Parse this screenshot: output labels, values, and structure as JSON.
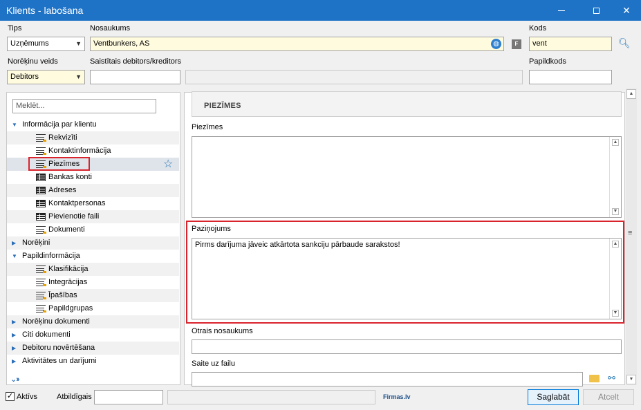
{
  "window": {
    "title": "Klients - labošana"
  },
  "header": {
    "tips_label": "Tips",
    "tips_value": "Uzņēmums",
    "nosaukums_label": "Nosaukums",
    "nosaukums_value": "Ventbunkers, AS",
    "f_label": "F",
    "kods_label": "Kods",
    "kods_value": "vent",
    "norekinu_veids_label": "Norēķinu veids",
    "norekinu_veids_value": "Debitors",
    "saistitais_label": "Saistītais debitors/kreditors",
    "saistitais_value": "",
    "papildkods_label": "Papildkods",
    "papildkods_value": ""
  },
  "tree": {
    "search_placeholder": "Meklēt...",
    "items": [
      {
        "label": "Informācija par klientu"
      },
      {
        "label": "Rekvizīti"
      },
      {
        "label": "Kontaktinformācija"
      },
      {
        "label": "Piezīmes"
      },
      {
        "label": "Bankas konti"
      },
      {
        "label": "Adreses"
      },
      {
        "label": "Kontaktpersonas"
      },
      {
        "label": "Pievienotie faili"
      },
      {
        "label": "Dokumenti"
      },
      {
        "label": "Norēķini"
      },
      {
        "label": "Papildinformācija"
      },
      {
        "label": "Klasifikācija"
      },
      {
        "label": "Integrācijas"
      },
      {
        "label": "Īpašības"
      },
      {
        "label": "Papildgrupas"
      },
      {
        "label": "Norēķinu dokumenti"
      },
      {
        "label": "Citi dokumenti"
      },
      {
        "label": "Debitoru novērtēšana"
      },
      {
        "label": "Aktivitātes un darījumi"
      }
    ]
  },
  "main": {
    "section_title": "PIEZĪMES",
    "piezimes_label": "Piezīmes",
    "piezimes_value": "",
    "pazinojums_label": "Paziņojums",
    "pazinojums_value": "Pirms darījuma jāveic atkārtota sankciju pārbaude sarakstos!",
    "otrais_label": "Otrais nosaukums",
    "otrais_value": "",
    "saite_label": "Saite uz failu",
    "saite_value": ""
  },
  "footer": {
    "aktivs_label": "Aktīvs",
    "aktivs_checked": true,
    "atbildigais_label": "Atbildīgais",
    "atbildigais_value": "",
    "brand": "Firmas.lv",
    "save_label": "Saglabāt",
    "cancel_label": "Atcelt"
  },
  "colors": {
    "titlebar": "#1e73c7",
    "highlight": "#d9232d",
    "required_field": "#fffbdf"
  }
}
